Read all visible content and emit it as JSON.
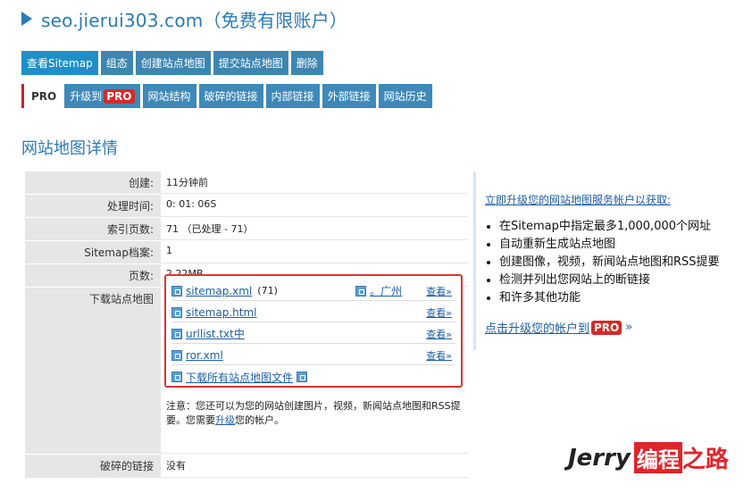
{
  "header": {
    "title": "seo.jierui303.com（免费有限账户）"
  },
  "tabs_primary": [
    {
      "label": "查看Sitemap"
    },
    {
      "label": "组态"
    },
    {
      "label": "创建站点地图"
    },
    {
      "label": "提交站点地图"
    },
    {
      "label": "删除"
    }
  ],
  "tabs_secondary": {
    "pro_label": "PRO",
    "upgrade_label": "升级到",
    "upgrade_badge": "PRO",
    "items": [
      {
        "label": "网站结构"
      },
      {
        "label": "破碎的链接"
      },
      {
        "label": "内部链接"
      },
      {
        "label": "外部链接"
      },
      {
        "label": "网站历史"
      }
    ]
  },
  "section_title": "网站地图详情",
  "details": {
    "created_key": "创建:",
    "created_val": "11分钟前",
    "proc_key": "处理时间:",
    "proc_val": "0: 01: 06S",
    "indexed_key": "索引页数:",
    "indexed_val": "71 （已处理 - 71）",
    "files_key": "Sitemap档案:",
    "files_val": "1",
    "size_key": "页数:",
    "size_val": "2.22MB",
    "download_key": "下载站点地图",
    "broken_key": "破碎的链接",
    "broken_val": "没有"
  },
  "downloads": {
    "items": [
      {
        "file": "sitemap.xml",
        "count": "(71)",
        "geo": "。广州",
        "view": "查看»"
      },
      {
        "file": "sitemap.html",
        "view": "查看»"
      },
      {
        "file": "urllist.txt中",
        "view": "查看»"
      },
      {
        "file": "ror.xml",
        "view": "查看»"
      }
    ],
    "all_label": "下载所有站点地图文件"
  },
  "note": {
    "prefix": "注意：您还可以为您的网站创建图片，视频，新闻站点地图和RSS提要。您需要",
    "link": "升级",
    "suffix": "您的帐户。"
  },
  "promo": {
    "head": "立即升级您的网站地图服务帐户以获取:",
    "items": [
      "在Sitemap中指定最多1,000,000个网址",
      "自动重新生成站点地图",
      "创建图像，视频，新闻站点地图和RSS提要",
      "检测并列出您网站上的断链接",
      "和许多其他功能"
    ],
    "foot_label": "点击升级您的帐户到",
    "foot_badge": "PRO",
    "foot_arrow": "»"
  },
  "watermark": {
    "brand": "Jerry",
    "cn": "编程",
    "cn2": "之路"
  },
  "colors": {
    "accent": "#2a7ab8",
    "tab": "#3a8dbd",
    "alert": "#e03333",
    "badge": "#d42a2a"
  }
}
